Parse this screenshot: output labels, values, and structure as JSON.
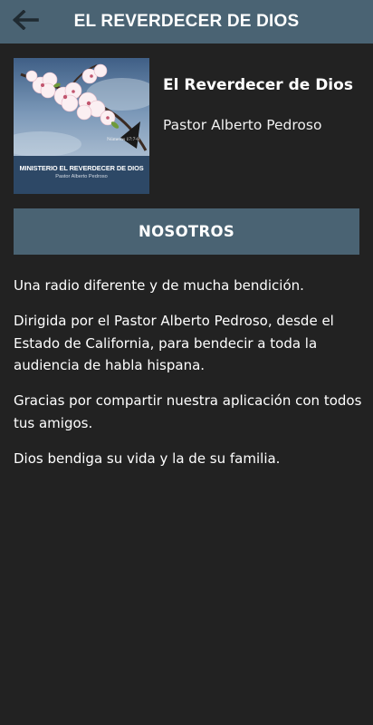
{
  "header": {
    "title": "EL REVERDECER DE DIOS",
    "back_icon": "arrow-left-icon"
  },
  "station": {
    "name": "El Reverdecer de Dios",
    "host": "Pastor Alberto Pedroso",
    "cover": {
      "ministry": "MINISTERIO EL REVERDECER DE DIOS",
      "pastor": "Pastor Alberto Pedroso",
      "verse": "Números 17:7-8"
    }
  },
  "section": {
    "label": "NOSOTROS"
  },
  "about": {
    "paragraphs": [
      "Una radio diferente y de mucha bendición.",
      "Dirigida por el Pastor Alberto Pedroso, desde el Estado de California, para bendecir a toda la audiencia de habla hispana.",
      "Gracias por compartir nuestra aplicación con todos tus amigos.",
      "Dios bendiga su vida y la de su familia."
    ]
  },
  "colors": {
    "background": "#222222",
    "bar": "#4a6373",
    "text": "#ffffff"
  }
}
